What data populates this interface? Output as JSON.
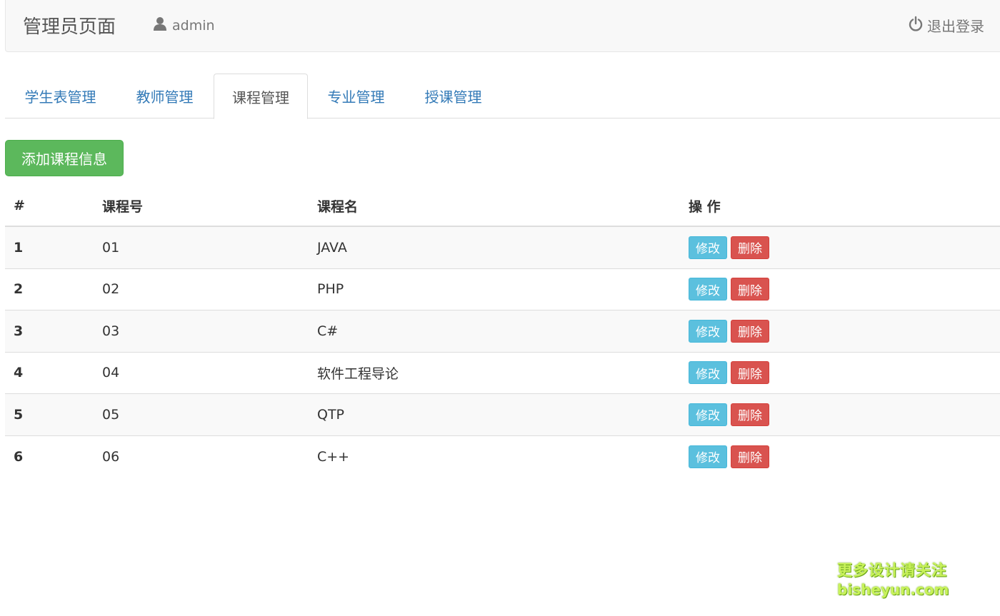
{
  "header": {
    "title": "管理员页面",
    "user": "admin",
    "logout": "退出登录"
  },
  "tabs": [
    {
      "label": "学生表管理"
    },
    {
      "label": "教师管理"
    },
    {
      "label": "课程管理",
      "active": true
    },
    {
      "label": "专业管理"
    },
    {
      "label": "授课管理"
    }
  ],
  "actions": {
    "add_label": "添加课程信息"
  },
  "table": {
    "headers": [
      "#",
      "课程号",
      "课程名",
      "操 作"
    ],
    "rows": [
      {
        "index": "1",
        "code": "01",
        "name": "JAVA"
      },
      {
        "index": "2",
        "code": "02",
        "name": "PHP"
      },
      {
        "index": "3",
        "code": "03",
        "name": "C#"
      },
      {
        "index": "4",
        "code": "04",
        "name": "软件工程导论"
      },
      {
        "index": "5",
        "code": "05",
        "name": "QTP"
      },
      {
        "index": "6",
        "code": "06",
        "name": "C++"
      }
    ],
    "edit_label": "修改",
    "delete_label": "删除"
  },
  "watermark": {
    "line1": "更多设计请关注",
    "line2": "bisheyun.com"
  },
  "colors": {
    "success": "#5cb85c",
    "info": "#5bc0de",
    "danger": "#d9534f",
    "link": "#337ab7"
  }
}
